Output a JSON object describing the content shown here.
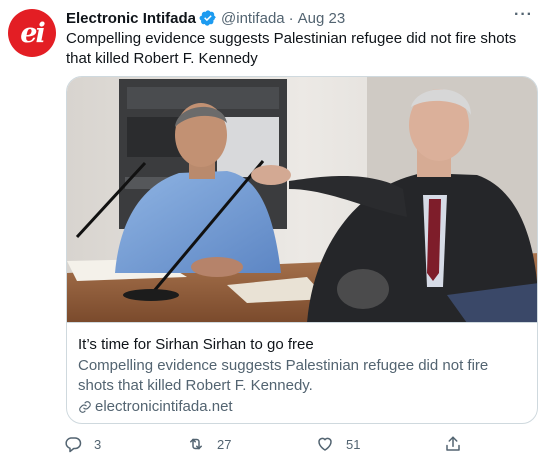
{
  "tweet": {
    "display_name": "Electronic Intifada",
    "handle": "@intifada",
    "separator": "·",
    "date": "Aug 23",
    "text": "Compelling evidence suggests Palestinian refugee did not fire shots that killed Robert F. Kennedy",
    "avatar_text": "ei",
    "more_label": "···"
  },
  "card": {
    "title": "It’s time for Sirhan Sirhan to go free",
    "description": "Compelling evidence suggests Palestinian refugee did not fire shots that killed Robert F. Kennedy.",
    "domain": "electronicintifada.net"
  },
  "actions": {
    "replies": "3",
    "retweets": "27",
    "likes": "51"
  },
  "colors": {
    "brand_red": "#e31e24",
    "verified_blue": "#1d9bf0",
    "secondary_text": "#536471",
    "border": "#cfd9de"
  },
  "icons": [
    "verified-badge-icon",
    "more-icon",
    "link-icon",
    "reply-icon",
    "retweet-icon",
    "like-icon",
    "share-icon"
  ]
}
